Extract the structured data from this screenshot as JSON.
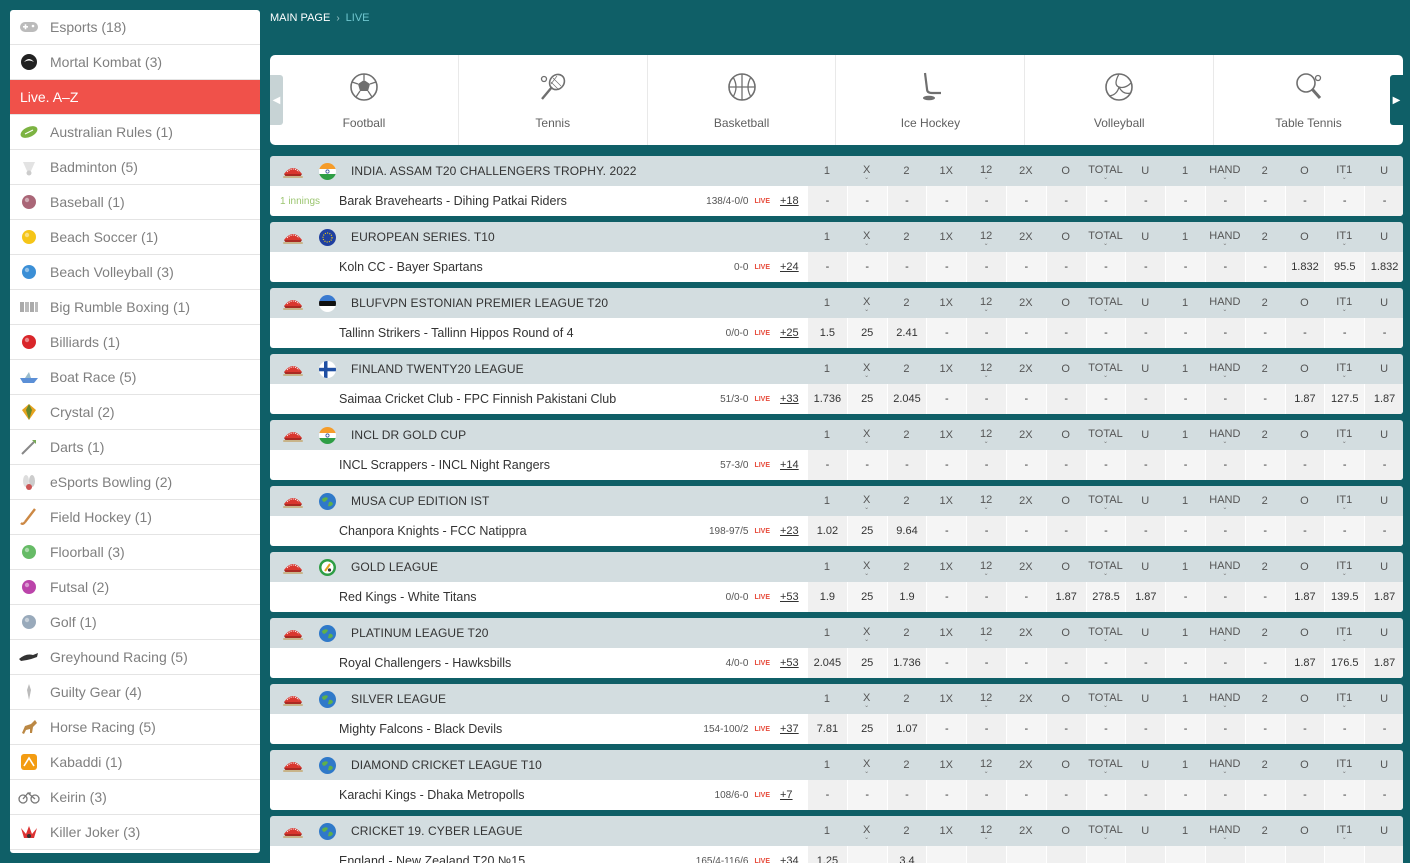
{
  "sidebar": {
    "items": [
      {
        "label": "Esports (18)",
        "icon": "gamepad-icon",
        "color": "#8aa"
      },
      {
        "label": "Mortal Kombat (3)",
        "icon": "dragon-icon",
        "color": "#222"
      },
      {
        "label": "Live. A–Z",
        "icon": "",
        "active": true
      },
      {
        "label": "Australian Rules (1)",
        "icon": "rugby-ball-icon",
        "color": "#7cb342"
      },
      {
        "label": "Badminton (5)",
        "icon": "shuttlecock-icon",
        "color": "#ccc"
      },
      {
        "label": "Baseball (1)",
        "icon": "baseball-icon",
        "color": "#a67"
      },
      {
        "label": "Beach Soccer (1)",
        "icon": "beach-ball-icon",
        "color": "#f5c518"
      },
      {
        "label": "Beach Volleyball (3)",
        "icon": "volleyball-icon",
        "color": "#3b8fd6"
      },
      {
        "label": "Big Rumble Boxing (1)",
        "icon": "boxing-icon",
        "color": "#aaa"
      },
      {
        "label": "Billiards (1)",
        "icon": "billiard-ball-icon",
        "color": "#d9262a"
      },
      {
        "label": "Boat Race (5)",
        "icon": "boat-icon",
        "color": "#5b8fd6"
      },
      {
        "label": "Crystal (2)",
        "icon": "crystal-icon",
        "color": "#e6a21e"
      },
      {
        "label": "Darts (1)",
        "icon": "darts-icon",
        "color": "#8a6"
      },
      {
        "label": "eSports Bowling (2)",
        "icon": "bowling-icon",
        "color": "#c55"
      },
      {
        "label": "Field Hockey (1)",
        "icon": "hockey-stick-icon",
        "color": "#c84"
      },
      {
        "label": "Floorball (3)",
        "icon": "floorball-icon",
        "color": "#6b6"
      },
      {
        "label": "Futsal (2)",
        "icon": "futsal-ball-icon",
        "color": "#b4a"
      },
      {
        "label": "Golf (1)",
        "icon": "golf-ball-icon",
        "color": "#9ab"
      },
      {
        "label": "Greyhound Racing (5)",
        "icon": "greyhound-icon",
        "color": "#333"
      },
      {
        "label": "Guilty Gear (4)",
        "icon": "guilty-gear-icon",
        "color": "#bbb"
      },
      {
        "label": "Horse Racing (5)",
        "icon": "horse-icon",
        "color": "#b84"
      },
      {
        "label": "Kabaddi (1)",
        "icon": "kabaddi-icon",
        "color": "#f39c12"
      },
      {
        "label": "Keirin (3)",
        "icon": "bicycle-icon",
        "color": "#777"
      },
      {
        "label": "Killer Joker (3)",
        "icon": "joker-icon",
        "color": "#c44"
      }
    ]
  },
  "breadcrumb": {
    "main": "MAIN PAGE",
    "sep": "›",
    "current": "LIVE"
  },
  "sports": [
    {
      "label": "Football",
      "icon": "football-icon"
    },
    {
      "label": "Tennis",
      "icon": "tennis-racket-icon"
    },
    {
      "label": "Basketball",
      "icon": "basketball-icon"
    },
    {
      "label": "Ice Hockey",
      "icon": "ice-hockey-icon"
    },
    {
      "label": "Volleyball",
      "icon": "volleyball-icon"
    },
    {
      "label": "Table Tennis",
      "icon": "table-tennis-icon"
    }
  ],
  "columns": [
    "1",
    "X",
    "2",
    "1X",
    "12",
    "2X",
    "O",
    "TOTAL",
    "U",
    "1",
    "HAND",
    "2",
    "O",
    "IT1",
    "U"
  ],
  "leagues": [
    {
      "name": "INDIA. ASSAM T20 CHALLENGERS TROPHY. 2022",
      "flag": "india",
      "extra": "1 innings",
      "teams": "Barak Bravehearts - Dihing Patkai Riders",
      "score": "138/4-0/0",
      "more": "+18",
      "odds": [
        "-",
        "-",
        "-",
        "-",
        "-",
        "-",
        "-",
        "-",
        "-",
        "-",
        "-",
        "-",
        "-",
        "-",
        "-"
      ]
    },
    {
      "name": "EUROPEAN SERIES. T10",
      "flag": "eu",
      "extra": "",
      "teams": "Koln CC - Bayer Spartans",
      "score": "0-0",
      "more": "+24",
      "odds": [
        "-",
        "-",
        "-",
        "-",
        "-",
        "-",
        "-",
        "-",
        "-",
        "-",
        "-",
        "-",
        "1.832",
        "95.5",
        "1.832"
      ]
    },
    {
      "name": "BLUFVPN ESTONIAN PREMIER LEAGUE T20",
      "flag": "estonia",
      "extra": "",
      "teams": "Tallinn Strikers - Tallinn Hippos Round of 4",
      "score": "0/0-0",
      "more": "+25",
      "odds": [
        "1.5",
        "25",
        "2.41",
        "-",
        "-",
        "-",
        "-",
        "-",
        "-",
        "-",
        "-",
        "-",
        "-",
        "-",
        "-"
      ]
    },
    {
      "name": "FINLAND TWENTY20 LEAGUE",
      "flag": "finland",
      "extra": "",
      "teams": "Saimaa Cricket Club - FPC Finnish Pakistani Club",
      "score": "51/3-0",
      "more": "+33",
      "odds": [
        "1.736",
        "25",
        "2.045",
        "-",
        "-",
        "-",
        "-",
        "-",
        "-",
        "-",
        "-",
        "-",
        "1.87",
        "127.5",
        "1.87"
      ]
    },
    {
      "name": "INCL DR GOLD CUP",
      "flag": "india",
      "extra": "",
      "teams": "INCL Scrappers - INCL Night Rangers",
      "score": "57-3/0",
      "more": "+14",
      "odds": [
        "-",
        "-",
        "-",
        "-",
        "-",
        "-",
        "-",
        "-",
        "-",
        "-",
        "-",
        "-",
        "-",
        "-",
        "-"
      ]
    },
    {
      "name": "MUSA CUP EDITION IST",
      "flag": "world",
      "extra": "",
      "teams": "Chanpora Knights - FCC Natippra",
      "score": "198-97/5",
      "more": "+23",
      "odds": [
        "1.02",
        "25",
        "9.64",
        "-",
        "-",
        "-",
        "-",
        "-",
        "-",
        "-",
        "-",
        "-",
        "-",
        "-",
        "-"
      ]
    },
    {
      "name": "GOLD LEAGUE",
      "flag": "cricket-world",
      "extra": "",
      "teams": "Red Kings - White Titans",
      "score": "0/0-0",
      "more": "+53",
      "odds": [
        "1.9",
        "25",
        "1.9",
        "-",
        "-",
        "-",
        "1.87",
        "278.5",
        "1.87",
        "-",
        "-",
        "-",
        "1.87",
        "139.5",
        "1.87"
      ]
    },
    {
      "name": "PLATINUM LEAGUE T20",
      "flag": "world",
      "extra": "",
      "teams": "Royal Challengers - Hawksbills",
      "score": "4/0-0",
      "more": "+53",
      "odds": [
        "2.045",
        "25",
        "1.736",
        "-",
        "-",
        "-",
        "-",
        "-",
        "-",
        "-",
        "-",
        "-",
        "1.87",
        "176.5",
        "1.87"
      ]
    },
    {
      "name": "SILVER LEAGUE",
      "flag": "world",
      "extra": "",
      "teams": "Mighty Falcons - Black Devils",
      "score": "154-100/2",
      "more": "+37",
      "odds": [
        "7.81",
        "25",
        "1.07",
        "-",
        "-",
        "-",
        "-",
        "-",
        "-",
        "-",
        "-",
        "-",
        "-",
        "-",
        "-"
      ]
    },
    {
      "name": "DIAMOND CRICKET LEAGUE T10",
      "flag": "world",
      "extra": "",
      "teams": "Karachi Kings - Dhaka Metropolls",
      "score": "108/6-0",
      "more": "+7",
      "odds": [
        "-",
        "-",
        "-",
        "-",
        "-",
        "-",
        "-",
        "-",
        "-",
        "-",
        "-",
        "-",
        "-",
        "-",
        "-"
      ]
    },
    {
      "name": "CRICKET 19. CYBER LEAGUE",
      "flag": "world",
      "extra": "",
      "teams": "England - New Zealand T20 №15",
      "score": "165/4-116/6",
      "more": "+34",
      "odds": [
        "1.25",
        "",
        "3.4",
        "",
        "",
        "",
        "",
        "",
        "",
        "",
        "",
        "",
        "",
        "",
        ""
      ]
    }
  ],
  "live_label": "LIVE",
  "colors": {
    "bg": "#0f5f67",
    "active": "#f0514a",
    "header": "#d3dde0"
  }
}
